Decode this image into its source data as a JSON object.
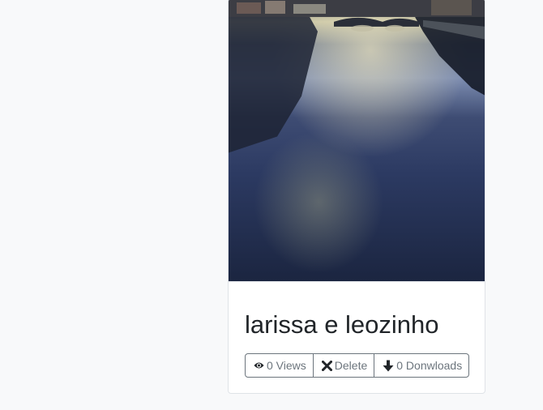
{
  "card": {
    "image_alt": "River and bridge at dusk with reflected sky",
    "title": "larissa e leozinho",
    "actions": {
      "views_label": "0 Views",
      "views_icon": "eye-icon",
      "delete_label": "Delete",
      "delete_icon": "close-icon",
      "downloads_label": "0 Donwloads",
      "downloads_icon": "arrow-down-icon"
    }
  },
  "colors": {
    "page_background": "#f8f9fa",
    "card_background": "#ffffff",
    "button_border": "#6c757d",
    "button_text": "#6c757d",
    "title_text": "#212529"
  }
}
